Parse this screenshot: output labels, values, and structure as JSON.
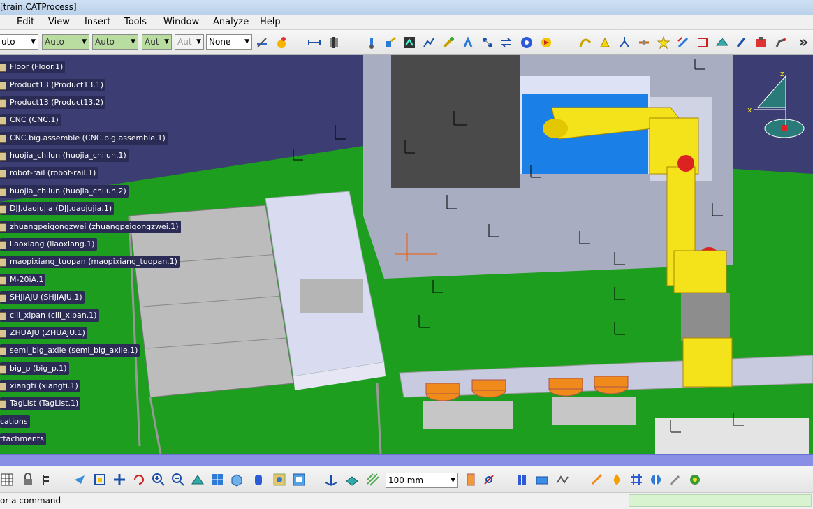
{
  "window": {
    "title": "[train.CATProcess]"
  },
  "menu": [
    "Edit",
    "View",
    "Insert",
    "Tools",
    "Window",
    "Analyze",
    "Help"
  ],
  "toolbar_top": {
    "combos": [
      {
        "value": "uto"
      },
      {
        "value": "Auto"
      },
      {
        "value": "Auto"
      },
      {
        "value": "Aut"
      },
      {
        "value": "Aut"
      },
      {
        "value": "None"
      }
    ]
  },
  "tree": [
    "Floor (Floor.1)",
    "Product13 (Product13.1)",
    "Product13 (Product13.2)",
    "CNC (CNC.1)",
    "CNC.big.assemble (CNC.big.assemble.1)",
    "huojia_chilun (huojia_chilun.1)",
    "robot-rail (robot-rail.1)",
    "huojia_chilun (huojia_chilun.2)",
    "DJJ.daojujia (DJJ.daojujia.1)",
    "zhuangpeigongzwei (zhuangpeigongzwei.1)",
    "liaoxiang (liaoxiang.1)",
    "maopixiang_tuopan (maopixiang_tuopan.1)",
    "M-20iA.1",
    "SHJIAJU (SHJIAJU.1)",
    "cili_xipan (cili_xipan.1)",
    "ZHUAJU (ZHUAJU.1)",
    "semi_big_axile (semi_big_axile.1)",
    "big_p (big_p.1)",
    "xiangti (xiangti.1)",
    "TagList (TagList.1)",
    "cations",
    "ttachments"
  ],
  "compass_labels": {
    "z": "z",
    "x": "x"
  },
  "toolbar_bottom": {
    "units_value": "100 mm"
  },
  "status": {
    "command_prompt": "or a command"
  },
  "colors": {
    "background": "#3c3d72",
    "floor": "#1e9e1e",
    "robot": "#f4e21a",
    "selection_bar": "#8a8fe6"
  }
}
